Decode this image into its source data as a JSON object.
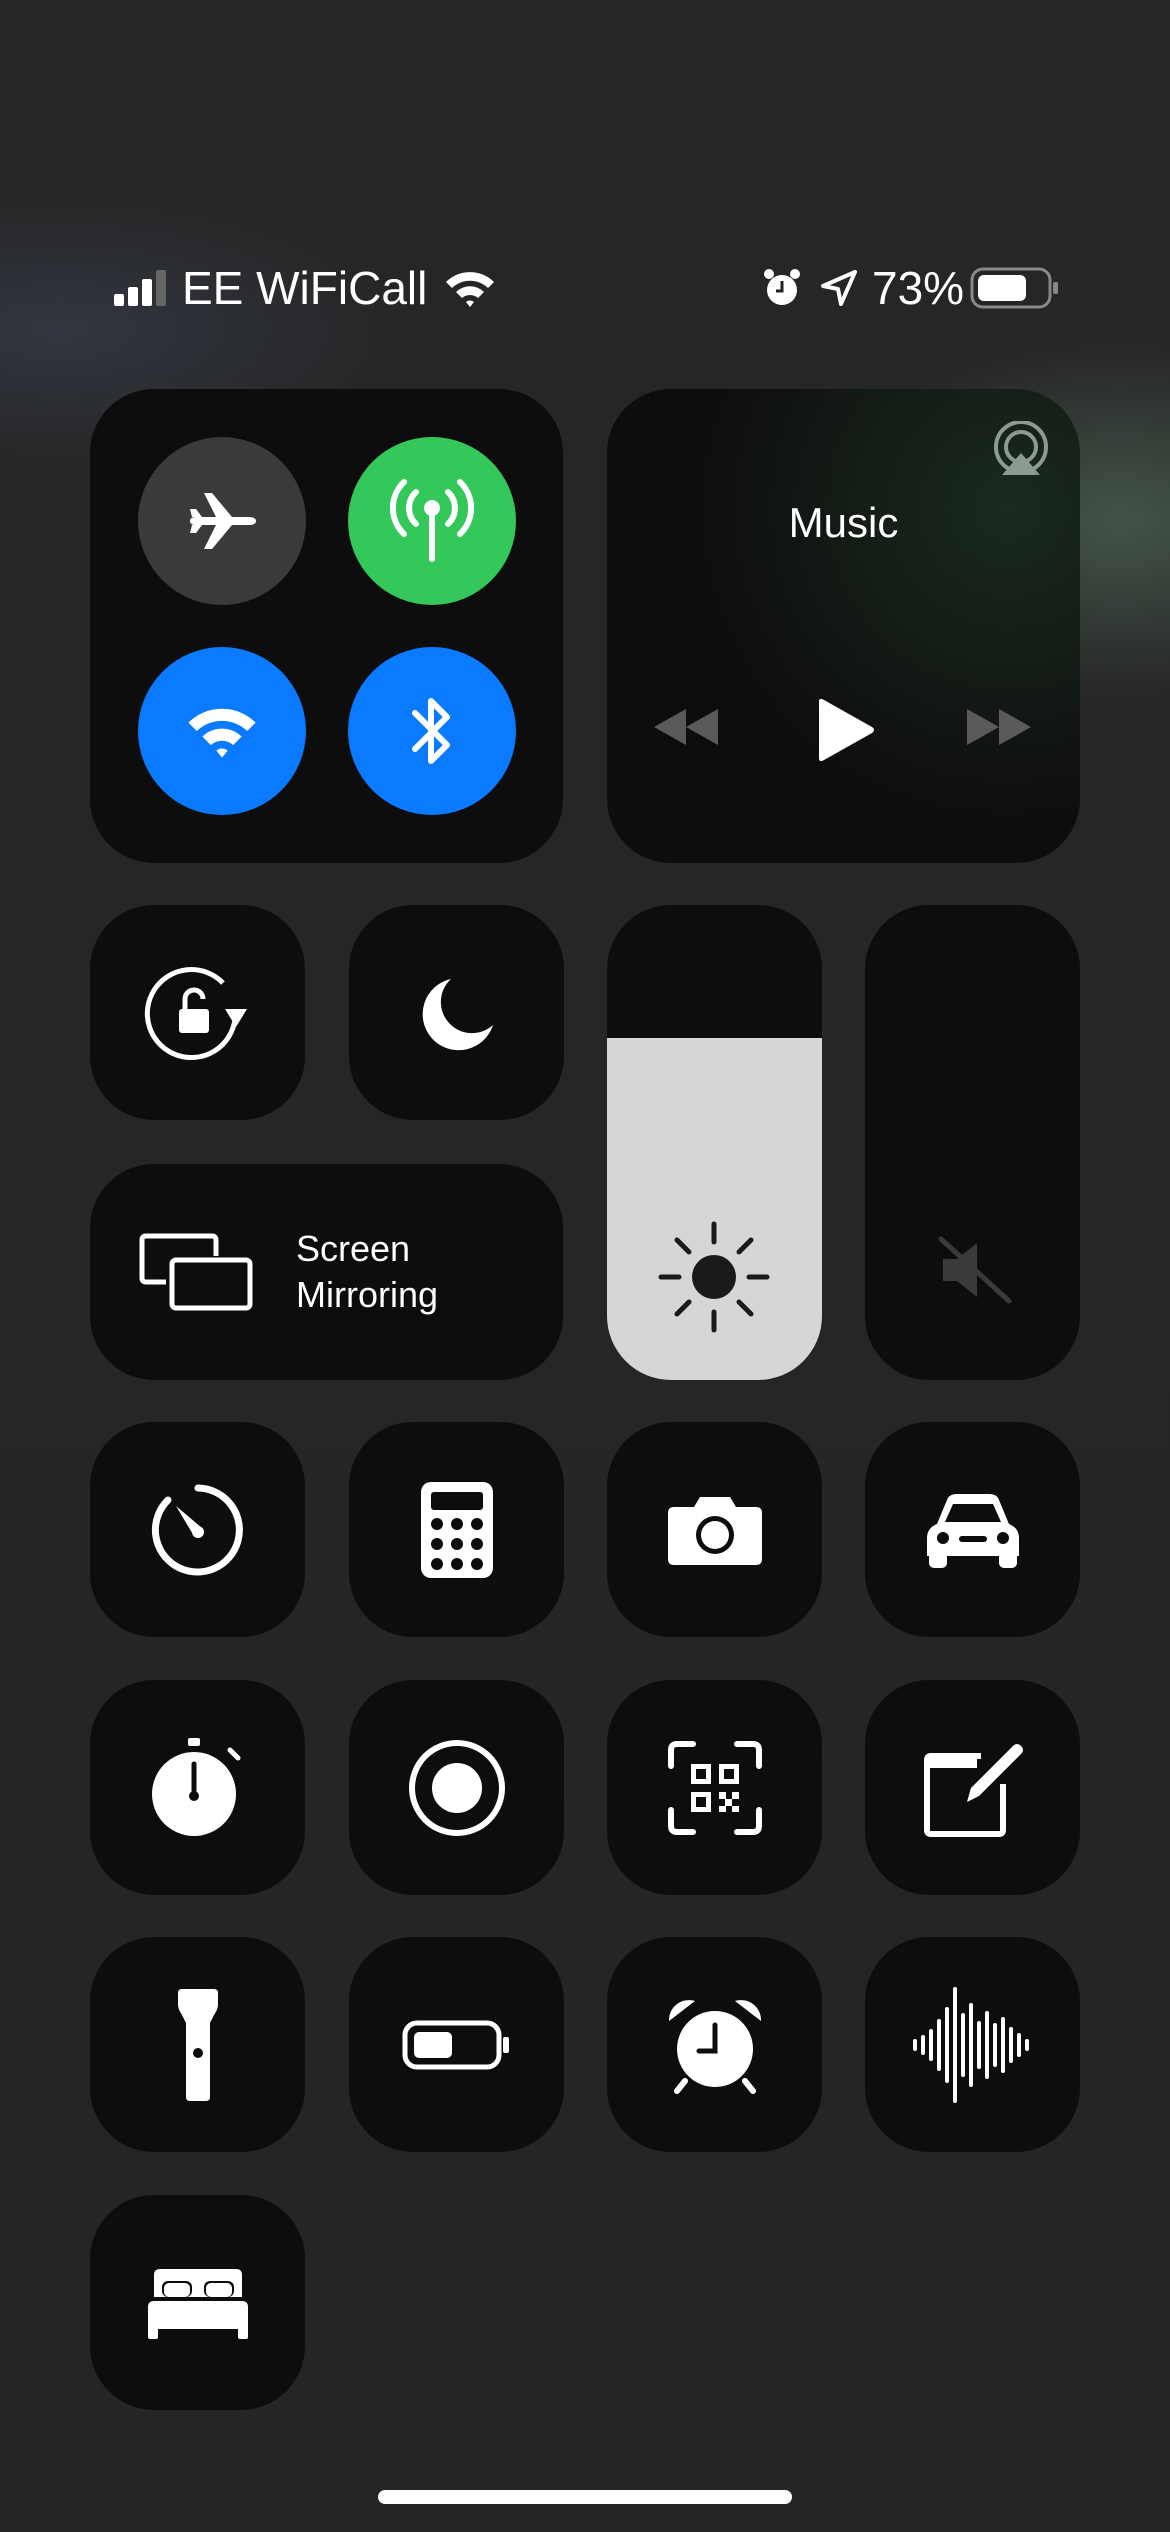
{
  "status_bar": {
    "carrier": "EE WiFiCall",
    "signal_bars": 3,
    "signal_max": 4,
    "battery_percent": "73%",
    "battery_level": 0.73,
    "icons": [
      "signal-icon",
      "wifi-icon",
      "alarm-icon",
      "location-icon",
      "battery-icon"
    ]
  },
  "connectivity": {
    "airplane_mode": false,
    "cellular_data": true,
    "wifi": true,
    "bluetooth": true,
    "colors": {
      "off": "#3a3a3c",
      "cellular": "#34c759",
      "blue": "#0a7aff"
    }
  },
  "music": {
    "title": "Music",
    "playing": false
  },
  "screen_mirroring": {
    "line1": "Screen",
    "line2": "Mirroring"
  },
  "brightness": {
    "level": 0.72
  },
  "volume": {
    "level": 0,
    "muted": true
  },
  "controls": [
    "orientation-lock",
    "do-not-disturb",
    "timer",
    "calculator",
    "camera",
    "driving-focus",
    "stopwatch",
    "screen-recording",
    "code-scanner",
    "notes",
    "flashlight",
    "low-power-mode",
    "alarm",
    "sound-recognition",
    "sleep-focus"
  ]
}
